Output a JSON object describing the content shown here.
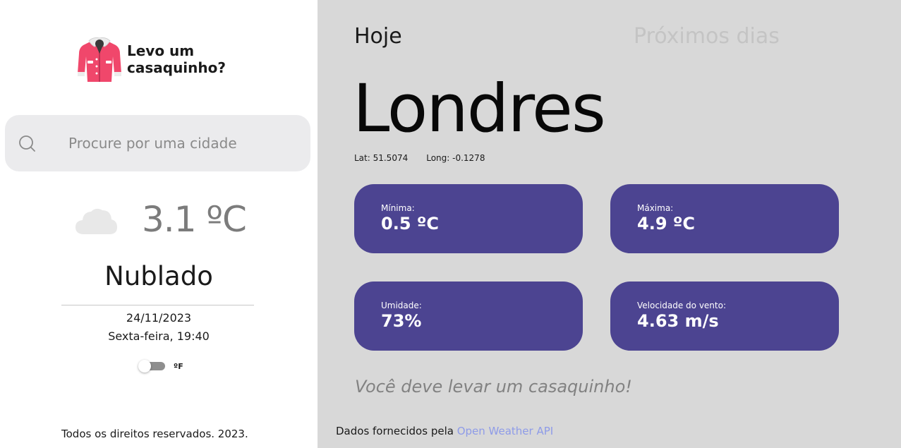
{
  "app": {
    "title": "Levo um casaquinho?"
  },
  "search": {
    "placeholder": "Procure por uma cidade",
    "value": ""
  },
  "current": {
    "temperature": "3.1 ºC",
    "condition": "Nublado",
    "date": "24/11/2023",
    "weekday_time": "Sexta-feira, 19:40",
    "weather_icon": "cloud-icon"
  },
  "toggle": {
    "label": "ºF",
    "checked": false
  },
  "footer": {
    "copyright": "Todos os direitos reservados. 2023."
  },
  "tabs": [
    {
      "label": "Hoje",
      "active": true
    },
    {
      "label": "Próximos dias",
      "active": false
    }
  ],
  "location": {
    "city": "Londres",
    "lat_label": "Lat: 51.5074",
    "long_label": "Long: -0.1278"
  },
  "stats": [
    {
      "label": "Mínima:",
      "value": "0.5 ºC"
    },
    {
      "label": "Máxima:",
      "value": "4.9 ºC"
    },
    {
      "label": "Umidade:",
      "value": "73%"
    },
    {
      "label": "Velocidade do vento:",
      "value": "4.63 m/s"
    }
  ],
  "advice": "Você deve levar um casaquinho!",
  "credits": {
    "prefix": "Dados fornecidos pela",
    "link_text": "Open Weather API"
  },
  "colors": {
    "card": "#4c4491",
    "main_bg": "#d8d8d8",
    "link": "#8e9be8",
    "coat": "#f0476b"
  }
}
